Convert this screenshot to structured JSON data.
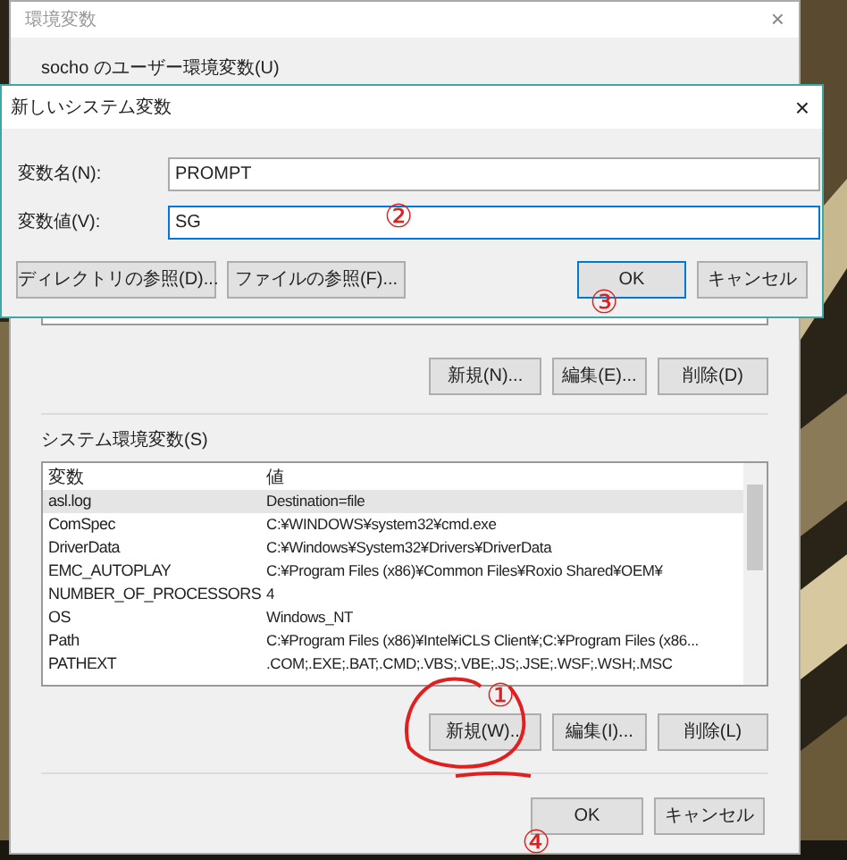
{
  "window": {
    "title": "環境変数",
    "close": "×"
  },
  "user_section": {
    "label": "socho のユーザー環境変数(U)",
    "buttons": [
      "新規(N)...",
      "編集(E)...",
      "削除(D)"
    ]
  },
  "system_section": {
    "label": "システム環境変数(S)",
    "columns": [
      "変数",
      "値"
    ],
    "rows": [
      {
        "name": "asl.log",
        "value": "Destination=file",
        "selected": true
      },
      {
        "name": "ComSpec",
        "value": "C:¥WINDOWS¥system32¥cmd.exe",
        "selected": false
      },
      {
        "name": "DriverData",
        "value": "C:¥Windows¥System32¥Drivers¥DriverData",
        "selected": false
      },
      {
        "name": "EMC_AUTOPLAY",
        "value": "C:¥Program Files (x86)¥Common Files¥Roxio Shared¥OEM¥",
        "selected": false
      },
      {
        "name": "NUMBER_OF_PROCESSORS",
        "value": "4",
        "selected": false
      },
      {
        "name": "OS",
        "value": "Windows_NT",
        "selected": false
      },
      {
        "name": "Path",
        "value": "C:¥Program Files (x86)¥Intel¥iCLS Client¥;C:¥Program Files (x86...",
        "selected": false
      },
      {
        "name": "PATHEXT",
        "value": ".COM;.EXE;.BAT;.CMD;.VBS;.VBE;.JS;.JSE;.WSF;.WSH;.MSC",
        "selected": false
      }
    ],
    "buttons": [
      "新規(W)...",
      "編集(I)...",
      "削除(L)"
    ]
  },
  "footer_buttons": [
    {
      "label": "OK",
      "default": false
    },
    {
      "label": "キャンセル",
      "default": false
    }
  ],
  "dialog": {
    "title": "新しいシステム変数",
    "close": "×",
    "fields": [
      {
        "label": "変数名(N):",
        "value": "PROMPT",
        "focused": false
      },
      {
        "label": "変数値(V):",
        "value": "SG",
        "focused": true
      }
    ],
    "buttons": [
      {
        "label": "ディレクトリの参照(D)...",
        "default": false
      },
      {
        "label": "ファイルの参照(F)...",
        "default": false
      },
      {
        "label": "OK",
        "default": true
      },
      {
        "label": "キャンセル",
        "default": false
      }
    ]
  },
  "annotations": [
    {
      "text": "①"
    },
    {
      "text": "②"
    },
    {
      "text": "③"
    },
    {
      "text": "④"
    }
  ]
}
